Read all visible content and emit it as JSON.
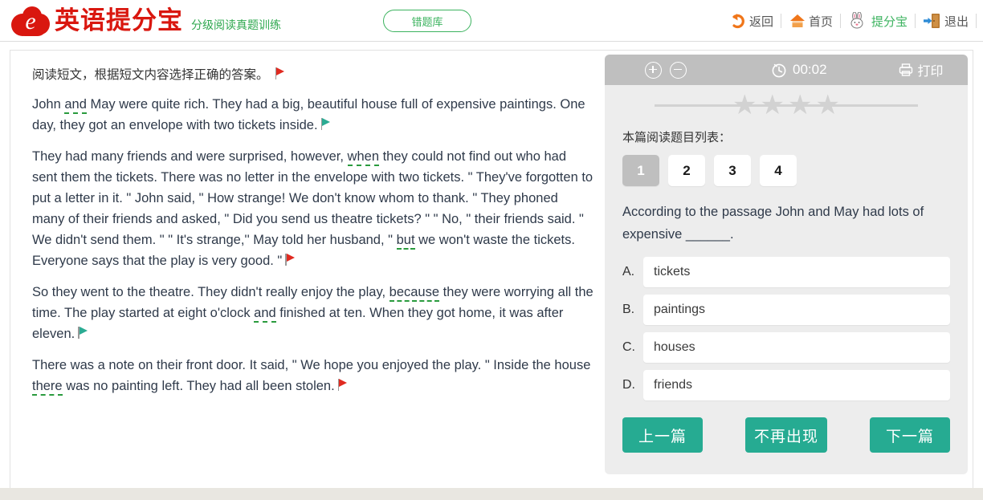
{
  "header": {
    "logo_letter": "e",
    "logo_icon": "cloud-logo",
    "brand_name": "英语提分宝",
    "brand_subtitle": "分级阅读真题训练",
    "wrongbank_label": "错题库",
    "brand_color": "#d9170f",
    "accent_green": "#3cb35f",
    "nav": [
      {
        "label": "返回",
        "icon": "back-arrow-icon"
      },
      {
        "label": "首页",
        "icon": "home-icon"
      },
      {
        "label": "提分宝",
        "icon": "rabbit-icon"
      },
      {
        "label": "退出",
        "icon": "exit-door-icon"
      }
    ]
  },
  "passage": {
    "instruction": "阅读短文，根据短文内容选择正确的答案。",
    "paragraphs": [
      {
        "parts": [
          {
            "t": "John "
          },
          {
            "t": "and",
            "underline": true
          },
          {
            "t": " May were quite rich. They had a big, beautiful house full of expensive paintings. One day, they got an envelope with two tickets inside."
          }
        ],
        "flag": "green"
      },
      {
        "parts": [
          {
            "t": "They had many friends and were surprised, however, "
          },
          {
            "t": "when",
            "underline": true
          },
          {
            "t": " they could not find out who had sent them the tickets. There was no letter in the envelope with two tickets. \" They've forgotten to put a letter in it. \" John said, \" How strange! We don't know whom to thank. \" They phoned many of their friends and asked, \" Did you send us theatre tickets? \" \" No, \" their friends said. \" We didn't send them. \" \" It's strange,'' May told her husband, \" "
          },
          {
            "t": "but",
            "underline": true
          },
          {
            "t": " we won't waste the tickets. Everyone says that the play is very good. \""
          }
        ],
        "flag": "red"
      },
      {
        "parts": [
          {
            "t": "So they went to the theatre. They didn't really enjoy the play, "
          },
          {
            "t": "because",
            "underline": true
          },
          {
            "t": " they were worrying all the time. The play started at eight o'clock "
          },
          {
            "t": "and",
            "underline": true
          },
          {
            "t": " finished at ten. When they got home, it was after eleven."
          }
        ],
        "flag": "green"
      },
      {
        "parts": [
          {
            "t": "There was a note on their front door. It said, \" We hope you enjoyed the play. \" Inside the house "
          },
          {
            "t": "there",
            "underline": true
          },
          {
            "t": " was no painting left. They had all been stolen."
          }
        ],
        "flag": "red"
      }
    ],
    "first_flag": "red"
  },
  "panel": {
    "toolbar": {
      "zoom_in_icon": "zoom-in-icon",
      "zoom_out_icon": "zoom-out-icon",
      "clock_icon": "clock-icon",
      "timer": "00:02",
      "print_icon": "printer-icon",
      "print_label": "打印"
    },
    "rating": {
      "stars": 4,
      "filled": 0,
      "star_color": "#d2d2d2"
    },
    "question_list_label": "本篇阅读题目列表：",
    "question_numbers": [
      "1",
      "2",
      "3",
      "4"
    ],
    "active_question": "1",
    "question_text": "According to the passage John and May had lots of expensive ______.",
    "options": [
      {
        "letter": "A.",
        "text": "tickets"
      },
      {
        "letter": "B.",
        "text": "paintings"
      },
      {
        "letter": "C.",
        "text": "houses"
      },
      {
        "letter": "D.",
        "text": "friends"
      }
    ],
    "actions": [
      {
        "label": "上一篇",
        "name": "prev-passage-button"
      },
      {
        "label": "不再出现",
        "name": "never-show-button"
      },
      {
        "label": "下一篇",
        "name": "next-passage-button"
      }
    ],
    "action_color": "#26ab92"
  }
}
